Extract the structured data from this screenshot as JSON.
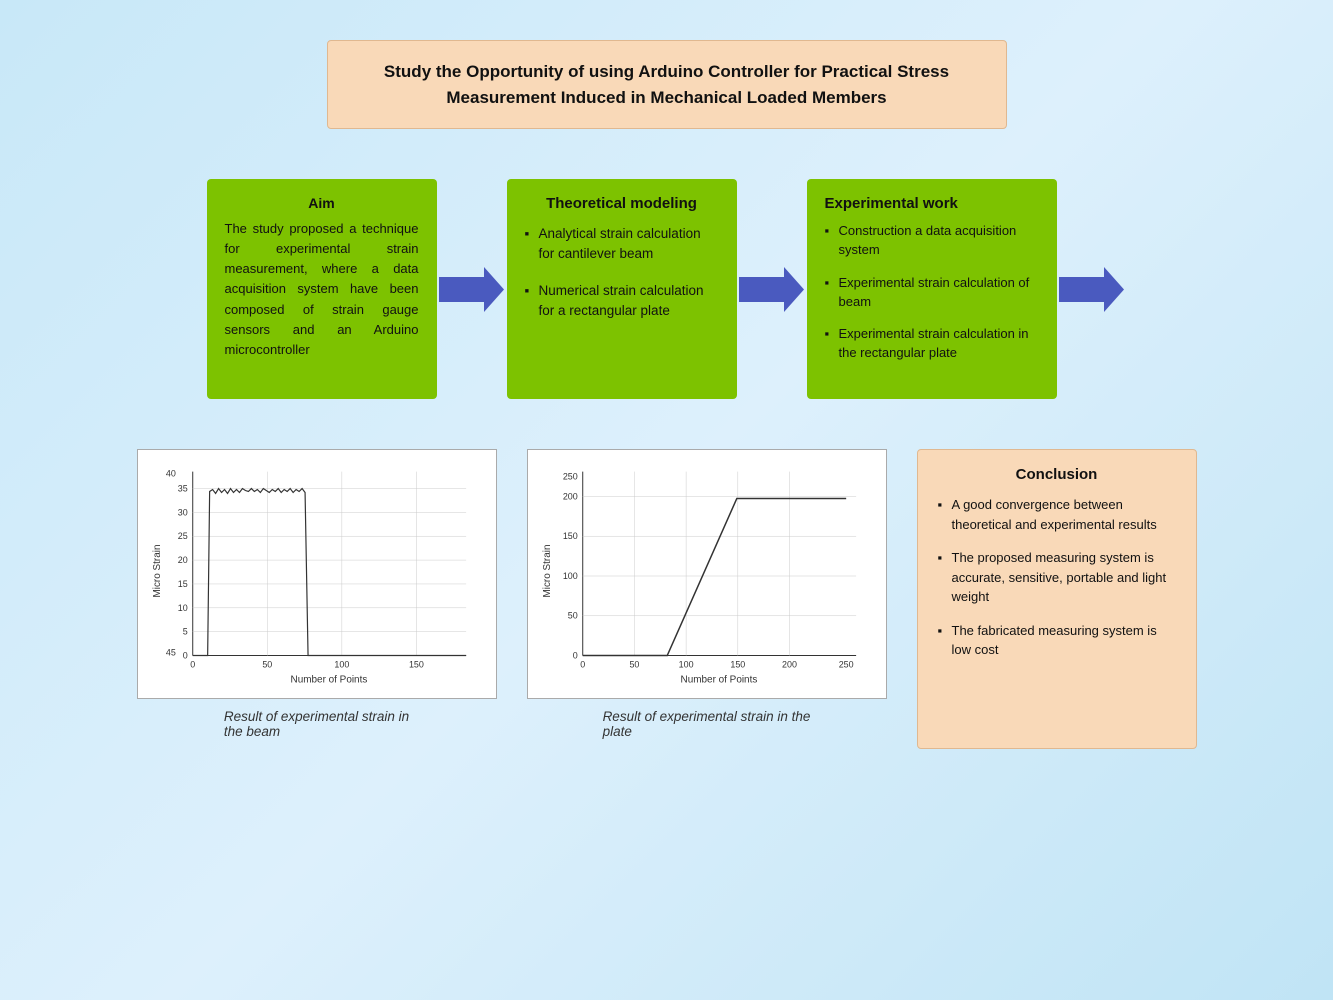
{
  "title": {
    "line1": "Study the Opportunity  of using Arduino  Controller  for Practical  Stress",
    "line2": "Measurement Induced  in Mechanical Loaded Members"
  },
  "aim": {
    "title": "Aim",
    "body": "The  study  proposed  a technique  for  experimental strain measurement,  where a data acquisition system have been  composed  of  strain gauge   sensors   and   an Arduino  microcontroller"
  },
  "theoretical": {
    "title": "Theoretical modeling",
    "items": [
      "Analytical strain calculation  for cantilever beam",
      "Numerical strain calculation  for a rectangular plate"
    ]
  },
  "experimental_work": {
    "title": "Experimental work",
    "items": [
      "Construction a data acquisition system",
      "Experimental strain calculation of beam",
      "Experimental strain calculation in the rectangular plate"
    ]
  },
  "chart1": {
    "caption_line1": "Result of experimental strain in",
    "caption_line2": "the beam",
    "x_label": "Number of Points",
    "y_label": "Micro Strain"
  },
  "chart2": {
    "caption_line1": "Result of experimental strain in the",
    "caption_line2": "plate",
    "x_label": "Number of Points",
    "y_label": "Micro Strain"
  },
  "conclusion": {
    "title": "Conclusion",
    "items": [
      "A good convergence between theoretical and experimental results",
      "The proposed measuring system is accurate, sensitive, portable and light weight",
      "The fabricated measuring system is low cost"
    ]
  }
}
